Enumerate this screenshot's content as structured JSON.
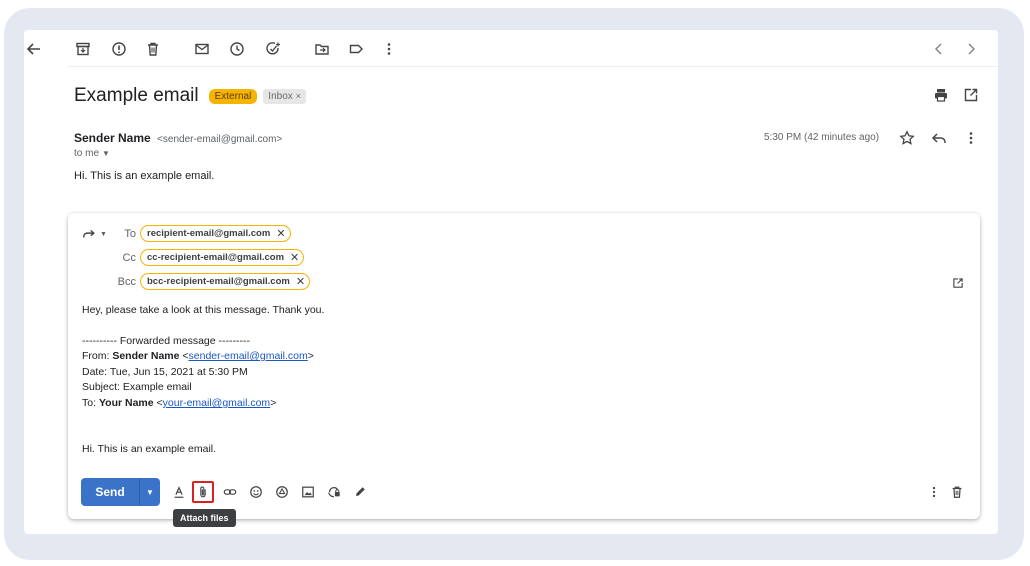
{
  "email": {
    "subject": "Example email",
    "label_external": "External",
    "label_inbox": "Inbox",
    "label_remove": "×",
    "sender_name": "Sender Name",
    "sender_email": "<sender-email@gmail.com>",
    "to_me": "to me",
    "timestamp": "5:30 PM (42 minutes ago)",
    "body": "Hi. This is an example email."
  },
  "compose": {
    "to_label": "To",
    "cc_label": "Cc",
    "bcc_label": "Bcc",
    "to_recipient": "recipient-email@gmail.com",
    "cc_recipient": "cc-recipient-email@gmail.com",
    "bcc_recipient": "bcc-recipient-email@gmail.com",
    "chip_remove": "✕",
    "message": "Hey, please take a look at this message. Thank you.",
    "forwarded_header": "---------- Forwarded message ---------",
    "from_label": "From:",
    "from_name": "Sender Name",
    "from_email": "sender-email@gmail.com",
    "date_line": "Date: Tue, Jun 15, 2021 at 5:30 PM",
    "subject_line": "Subject: Example email",
    "to_label2": "To:",
    "to_name": "Your Name",
    "to_email": "your-email@gmail.com",
    "lt": "<",
    "gt": ">",
    "quoted_body": "Hi. This is an example email.",
    "send_label": "Send",
    "tooltip": "Attach files"
  },
  "icons": {
    "toolbar": [
      "back-arrow-icon",
      "archive-icon",
      "report-spam-icon",
      "delete-icon",
      "mark-unread-icon",
      "snooze-icon",
      "add-to-tasks-icon",
      "move-to-icon",
      "label-icon",
      "more-vert-icon",
      "prev-icon",
      "next-icon"
    ],
    "header": [
      "print-icon",
      "open-new-window-icon",
      "star-icon",
      "reply-icon",
      "more-vert-icon"
    ],
    "format": [
      "formatting-icon",
      "attach-icon",
      "link-icon",
      "emoji-icon",
      "drive-icon",
      "photo-icon",
      "confidential-icon",
      "signature-icon",
      "more-options-icon",
      "discard-icon"
    ]
  },
  "colors": {
    "accent_send": "#3b73c9",
    "external_badge": "#f5b400",
    "chip_border": "#f5b400",
    "highlight": "#d92121",
    "link": "#1a57c4"
  }
}
